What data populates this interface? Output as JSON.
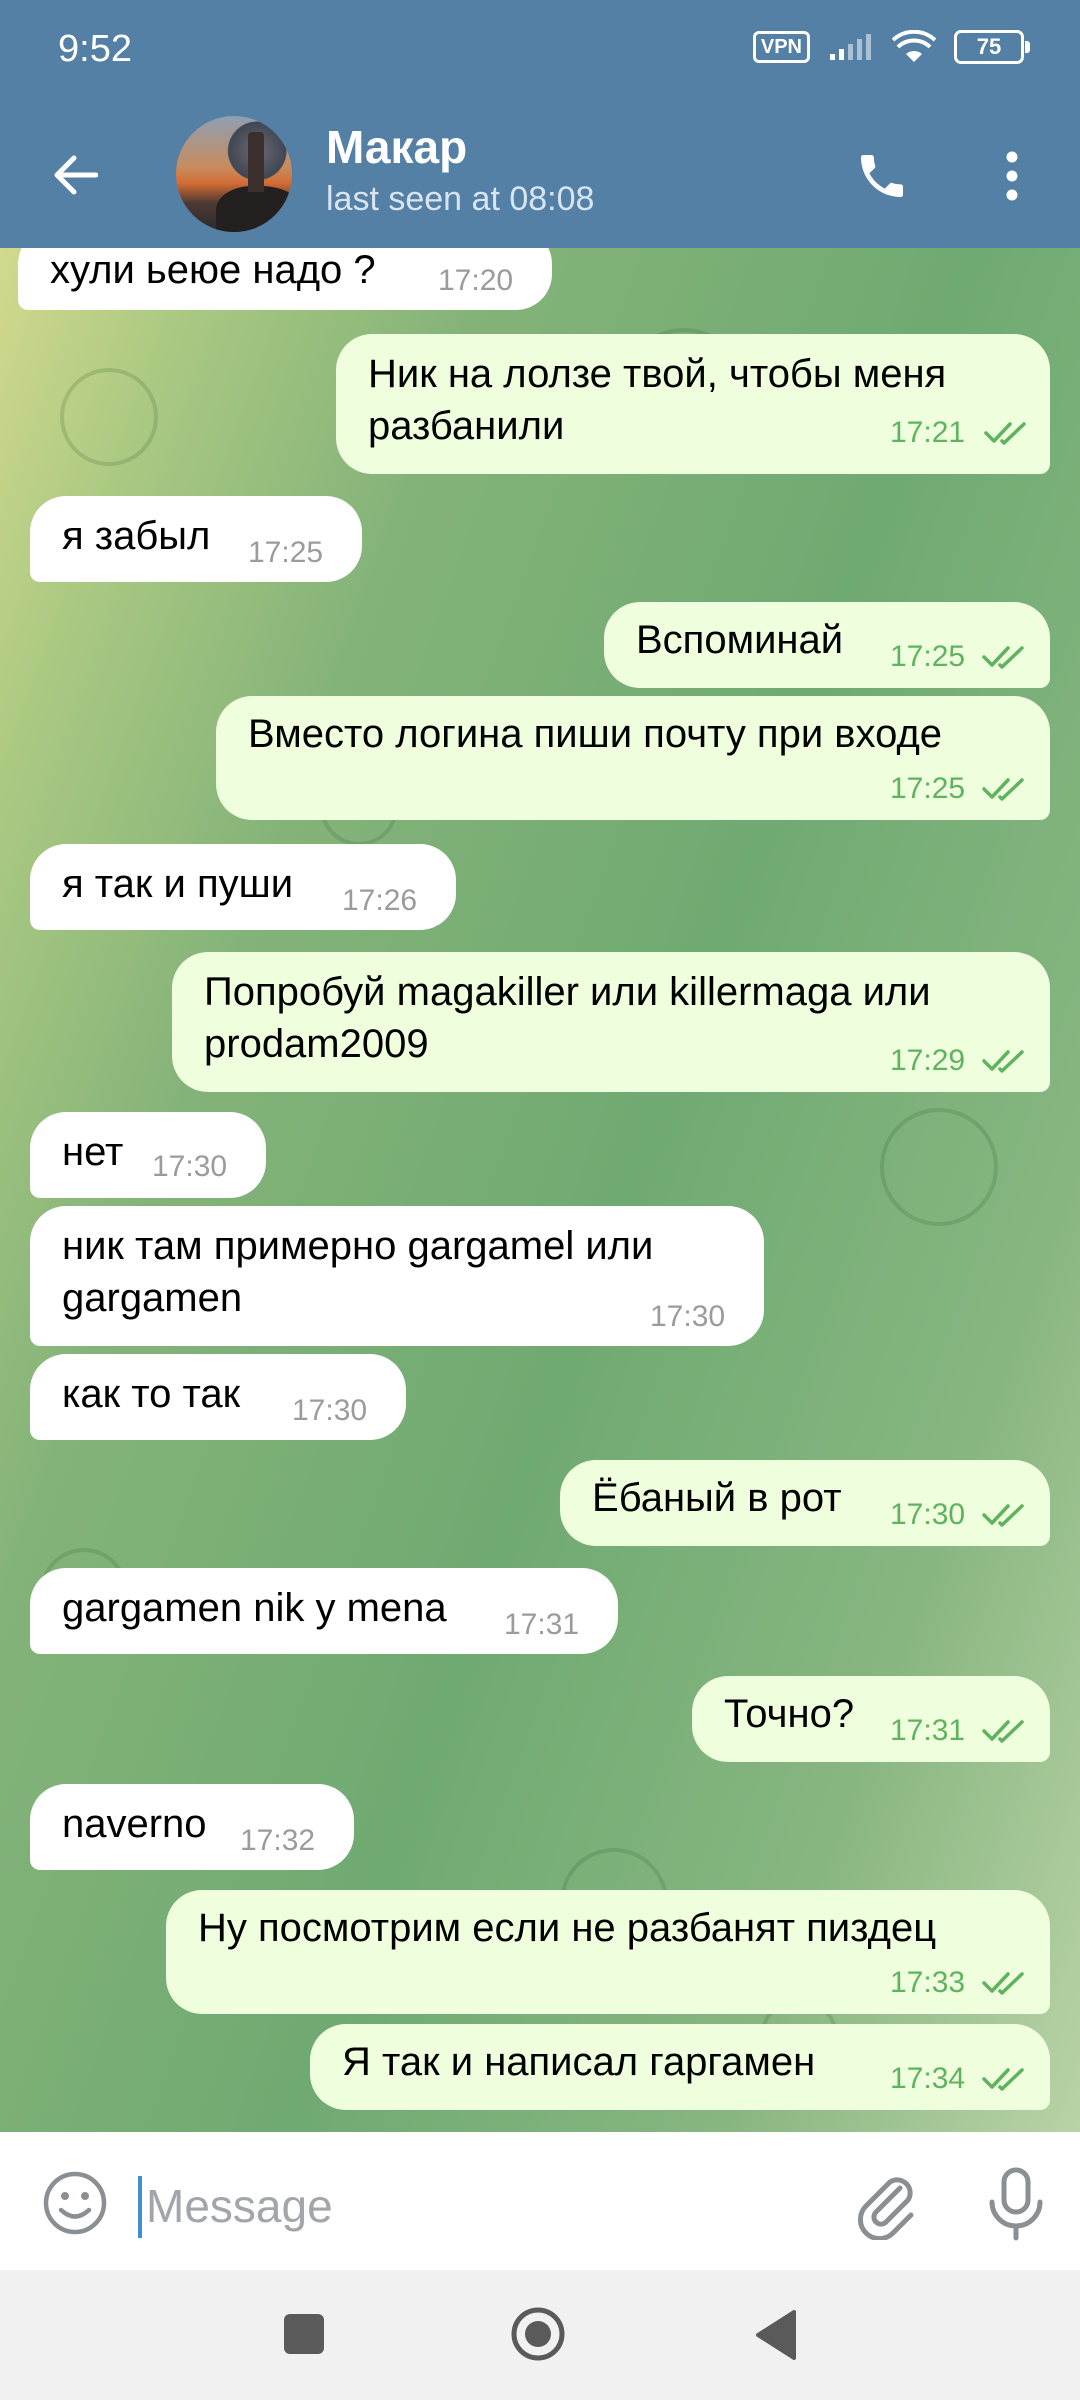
{
  "status_bar": {
    "time": "9:52",
    "vpn": "VPN",
    "battery": "75"
  },
  "header": {
    "contact_name": "Макар",
    "last_seen": "last seen at 08:08"
  },
  "messages": [
    {
      "dir": "in",
      "text": "хули ьеюе надо ?",
      "time": "17:20"
    },
    {
      "dir": "out",
      "text": "Ник на лолзе твой, чтобы меня\nразбанили",
      "time": "17:21",
      "read": true
    },
    {
      "dir": "in",
      "text": "я забыл",
      "time": "17:25"
    },
    {
      "dir": "out",
      "text": "Вспоминай",
      "time": "17:25",
      "read": true
    },
    {
      "dir": "out",
      "text": "Вместо логина пиши почту при входе",
      "time": "17:25",
      "read": true
    },
    {
      "dir": "in",
      "text": "я так и пуши",
      "time": "17:26"
    },
    {
      "dir": "out",
      "text": "Попробуй magakiller или killermaga или\nprodam2009",
      "time": "17:29",
      "read": true
    },
    {
      "dir": "in",
      "text": "нет",
      "time": "17:30"
    },
    {
      "dir": "in",
      "text": "ник там примерно gargamel или\ngargamen",
      "time": "17:30"
    },
    {
      "dir": "in",
      "text": "как то так",
      "time": "17:30"
    },
    {
      "dir": "out",
      "text": "Ёбаный в рот",
      "time": "17:30",
      "read": true
    },
    {
      "dir": "in",
      "text": "gargamen nik y mena",
      "time": "17:31"
    },
    {
      "dir": "out",
      "text": "Точно?",
      "time": "17:31",
      "read": true
    },
    {
      "dir": "in",
      "text": "naverno",
      "time": "17:32"
    },
    {
      "dir": "out",
      "text": "Ну посмотрим если не разбанят пиздец",
      "time": "17:33",
      "read": true
    },
    {
      "dir": "out",
      "text": "Я так и написал гаргамен",
      "time": "17:34",
      "read": true
    }
  ],
  "input": {
    "placeholder": "Message"
  },
  "colors": {
    "header": "#5480a6",
    "outgoing_bubble": "#effedd",
    "incoming_bubble": "#ffffff",
    "read_ticks": "#5fb35f"
  },
  "icons": [
    "back-arrow-icon",
    "phone-icon",
    "more-vertical-icon",
    "emoji-icon",
    "paperclip-icon",
    "microphone-icon"
  ]
}
